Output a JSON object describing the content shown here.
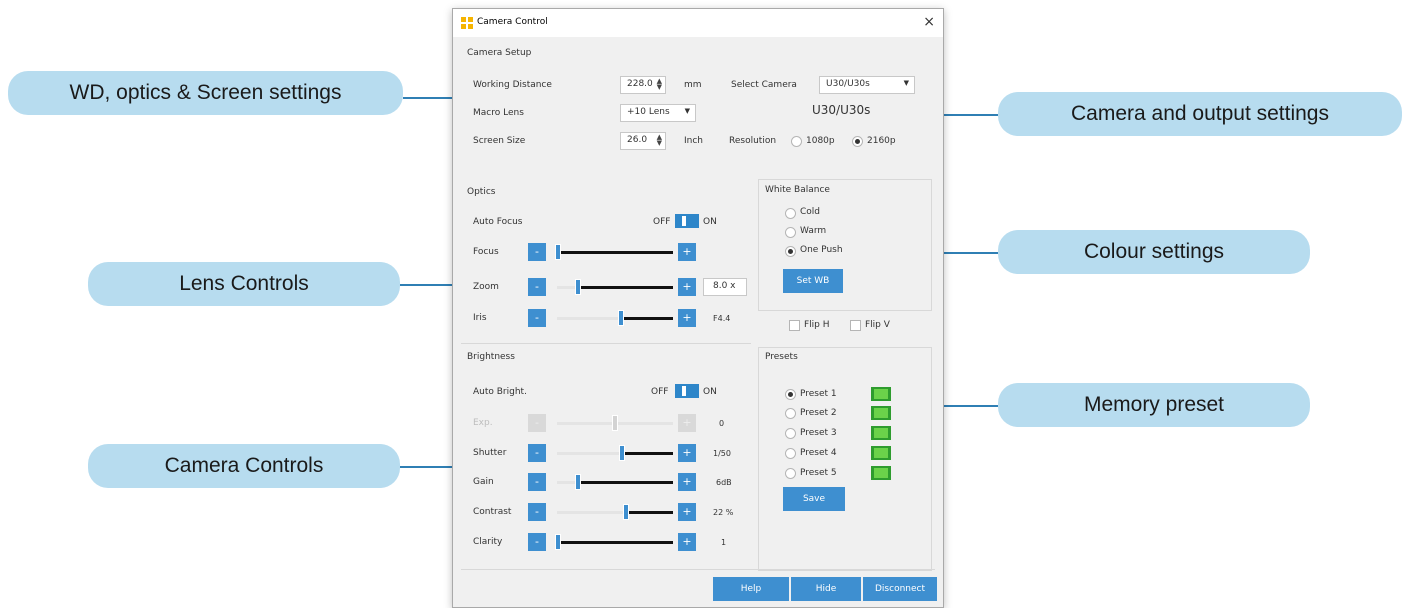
{
  "callouts": {
    "wd_optics": "WD, optics & Screen settings",
    "camera_output": "Camera and output settings",
    "lens_controls": "Lens Controls",
    "colour": "Colour settings",
    "camera_controls": "Camera Controls",
    "memory_preset": "Memory preset"
  },
  "window": {
    "title": "Camera Control",
    "close": "×"
  },
  "camera_setup": {
    "heading": "Camera Setup",
    "working_distance_label": "Working Distance",
    "working_distance_value": "228.0",
    "working_distance_unit": "mm",
    "macro_lens_label": "Macro Lens",
    "macro_lens_value": "+10 Lens",
    "screen_size_label": "Screen Size",
    "screen_size_value": "26.0",
    "screen_size_unit": "Inch",
    "select_camera_label": "Select Camera",
    "select_camera_value": "U30/U30s",
    "camera_name": "U30/U30s",
    "resolution_label": "Resolution",
    "res_1080": "1080p",
    "res_2160": "2160p",
    "resolution_selected": "2160p"
  },
  "optics": {
    "heading": "Optics",
    "auto_focus_label": "Auto Focus",
    "off": "OFF",
    "on": "ON",
    "focus_label": "Focus",
    "zoom_label": "Zoom",
    "zoom_value": "8.0 x",
    "iris_label": "Iris",
    "iris_value": "F4.4"
  },
  "white_balance": {
    "heading": "White Balance",
    "cold": "Cold",
    "warm": "Warm",
    "one_push": "One Push",
    "selected": "One Push",
    "set_wb": "Set WB",
    "flip_h": "Flip H",
    "flip_v": "Flip V"
  },
  "brightness": {
    "heading": "Brightness",
    "auto_bright_label": "Auto Bright.",
    "off": "OFF",
    "on": "ON",
    "exp_label": "Exp.",
    "exp_value": "0",
    "shutter_label": "Shutter",
    "shutter_value": "1/50",
    "gain_label": "Gain",
    "gain_value": "6dB",
    "contrast_label": "Contrast",
    "contrast_value": "22 %",
    "clarity_label": "Clarity",
    "clarity_value": "1"
  },
  "presets": {
    "heading": "Presets",
    "items": [
      "Preset 1",
      "Preset 2",
      "Preset 3",
      "Preset 4",
      "Preset 5"
    ],
    "selected": "Preset 1",
    "save": "Save"
  },
  "footer": {
    "help": "Help",
    "hide": "Hide",
    "disconnect": "Disconnect"
  },
  "buttons": {
    "minus": "-",
    "plus": "+"
  },
  "colors": {
    "accent": "#3e8fd0",
    "callout_bg": "#b7dcef",
    "leader": "#2f7fb4",
    "preset_green": "#2e9c2e"
  }
}
